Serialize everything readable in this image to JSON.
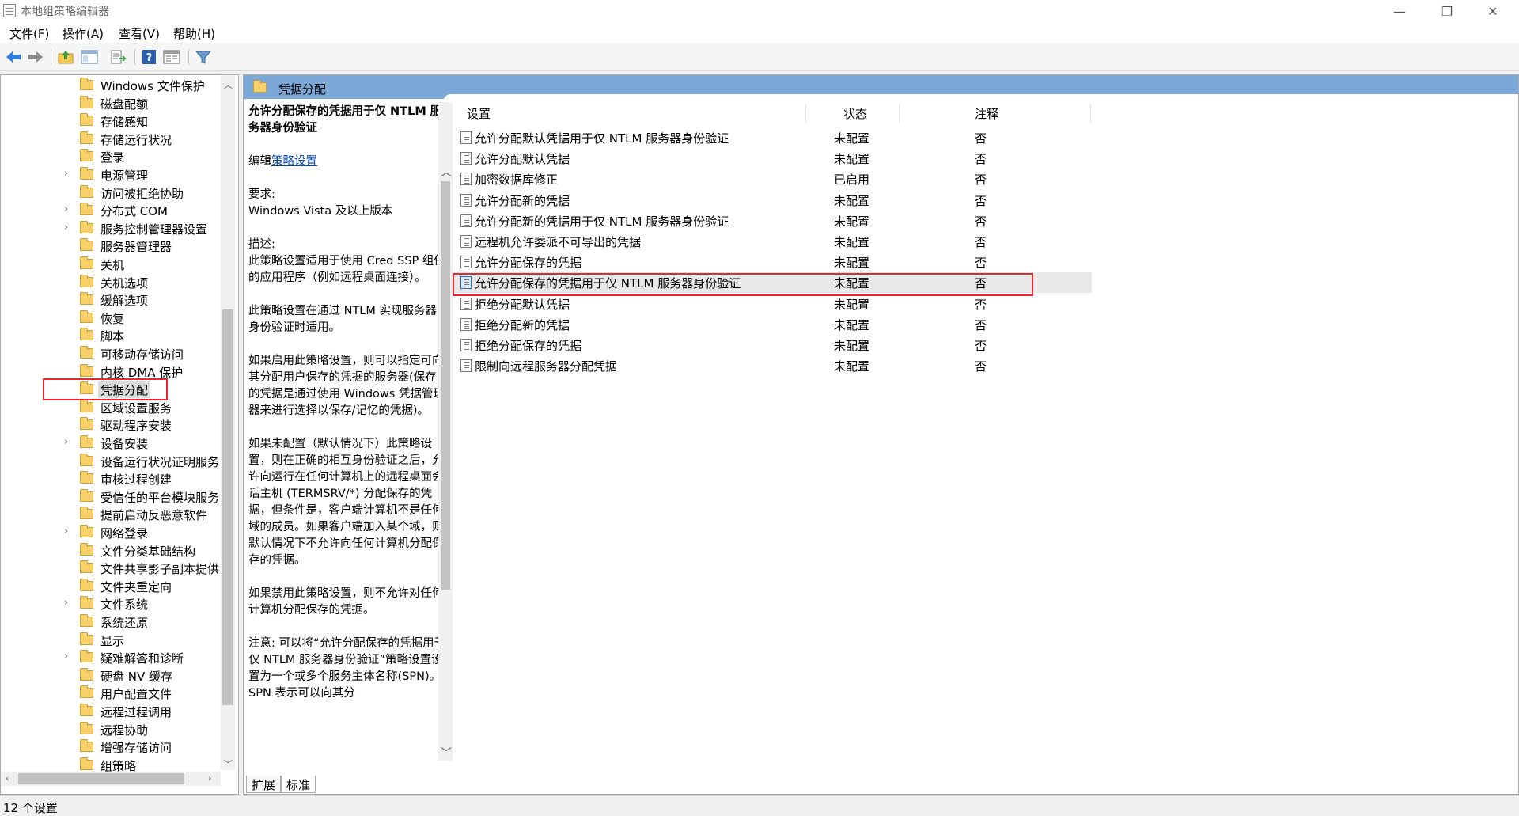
{
  "window": {
    "title": "本地组策略编辑器",
    "minimize": "—",
    "restore": "❐",
    "close": "✕"
  },
  "menu": [
    "文件(F)",
    "操作(A)",
    "查看(V)",
    "帮助(H)"
  ],
  "toolbar": [
    "back-icon",
    "forward-icon",
    "up-folder-icon",
    "show-hide-tree-icon",
    "export-list-icon",
    "help-icon",
    "properties-icon",
    "filter-icon"
  ],
  "tree": [
    {
      "label": "Windows 文件保护",
      "expandable": false
    },
    {
      "label": "磁盘配额",
      "expandable": false
    },
    {
      "label": "存储感知",
      "expandable": false
    },
    {
      "label": "存储运行状况",
      "expandable": false
    },
    {
      "label": "登录",
      "expandable": false
    },
    {
      "label": "电源管理",
      "expandable": true
    },
    {
      "label": "访问被拒绝协助",
      "expandable": false
    },
    {
      "label": "分布式 COM",
      "expandable": true
    },
    {
      "label": "服务控制管理器设置",
      "expandable": true
    },
    {
      "label": "服务器管理器",
      "expandable": false
    },
    {
      "label": "关机",
      "expandable": false
    },
    {
      "label": "关机选项",
      "expandable": false
    },
    {
      "label": "缓解选项",
      "expandable": false
    },
    {
      "label": "恢复",
      "expandable": false
    },
    {
      "label": "脚本",
      "expandable": false
    },
    {
      "label": "可移动存储访问",
      "expandable": false
    },
    {
      "label": "内核 DMA 保护",
      "expandable": false
    },
    {
      "label": "凭据分配",
      "expandable": false,
      "selected": true
    },
    {
      "label": "区域设置服务",
      "expandable": false
    },
    {
      "label": "驱动程序安装",
      "expandable": false
    },
    {
      "label": "设备安装",
      "expandable": true
    },
    {
      "label": "设备运行状况证明服务",
      "expandable": false
    },
    {
      "label": "审核过程创建",
      "expandable": false
    },
    {
      "label": "受信任的平台模块服务",
      "expandable": false
    },
    {
      "label": "提前启动反恶意软件",
      "expandable": false
    },
    {
      "label": "网络登录",
      "expandable": true
    },
    {
      "label": "文件分类基础结构",
      "expandable": false
    },
    {
      "label": "文件共享影子副本提供",
      "expandable": false
    },
    {
      "label": "文件夹重定向",
      "expandable": false
    },
    {
      "label": "文件系统",
      "expandable": true
    },
    {
      "label": "系统还原",
      "expandable": false
    },
    {
      "label": "显示",
      "expandable": false
    },
    {
      "label": "疑难解答和诊断",
      "expandable": true
    },
    {
      "label": "硬盘 NV 缓存",
      "expandable": false
    },
    {
      "label": "用户配置文件",
      "expandable": false
    },
    {
      "label": "远程过程调用",
      "expandable": false
    },
    {
      "label": "远程协助",
      "expandable": false
    },
    {
      "label": "增强存储访问",
      "expandable": false
    },
    {
      "label": "组策略",
      "expandable": false
    }
  ],
  "header": {
    "title": "凭据分配"
  },
  "description": {
    "title": "允许分配保存的凭据用于仅 NTLM 服务器身份验证",
    "edit_prefix": "编辑",
    "edit_link": "策略设置",
    "req_label": "要求:",
    "req_value": "Windows Vista 及以上版本",
    "desc_label": "描述:",
    "p1": "此策略设置适用于使用 Cred SSP 组件的应用程序（例如远程桌面连接）。",
    "p2": "此策略设置在通过 NTLM 实现服务器身份验证时适用。",
    "p3": "如果启用此策略设置，则可以指定可向其分配用户保存的凭据的服务器(保存的凭据是通过使用 Windows 凭据管理器来进行选择以保存/记忆的凭据)。",
    "p4": "如果未配置（默认情况下）此策略设置，则在正确的相互身份验证之后，允许向运行在任何计算机上的远程桌面会话主机 (TERMSRV/*) 分配保存的凭据，但条件是，客户端计算机不是任何域的成员。如果客户端加入某个域，则默认情况下不允许向任何计算机分配保存的凭据。",
    "p5": "如果禁用此策略设置，则不允许对任何计算机分配保存的凭据。",
    "p6": "注意: 可以将“允许分配保存的凭据用于仅 NTLM 服务器身份验证”策略设置设置为一个或多个服务主体名称(SPN)。SPN 表示可以向其分"
  },
  "columns": {
    "setting": "设置",
    "state": "状态",
    "note": "注释"
  },
  "policies": [
    {
      "name": "允许分配默认凭据用于仅 NTLM 服务器身份验证",
      "state": "未配置",
      "note": "否"
    },
    {
      "name": "允许分配默认凭据",
      "state": "未配置",
      "note": "否"
    },
    {
      "name": "加密数据库修正",
      "state": "已启用",
      "note": "否"
    },
    {
      "name": "允许分配新的凭据",
      "state": "未配置",
      "note": "否"
    },
    {
      "name": "允许分配新的凭据用于仅 NTLM 服务器身份验证",
      "state": "未配置",
      "note": "否"
    },
    {
      "name": "远程机允许委派不可导出的凭据",
      "state": "未配置",
      "note": "否"
    },
    {
      "name": "允许分配保存的凭据",
      "state": "未配置",
      "note": "否"
    },
    {
      "name": "允许分配保存的凭据用于仅 NTLM 服务器身份验证",
      "state": "未配置",
      "note": "否",
      "selected": true
    },
    {
      "name": "拒绝分配默认凭据",
      "state": "未配置",
      "note": "否"
    },
    {
      "name": "拒绝分配新的凭据",
      "state": "未配置",
      "note": "否"
    },
    {
      "name": "拒绝分配保存的凭据",
      "state": "未配置",
      "note": "否"
    },
    {
      "name": "限制向远程服务器分配凭据",
      "state": "未配置",
      "note": "否"
    }
  ],
  "tabs": [
    "扩展",
    "标准"
  ],
  "status": "12 个设置",
  "colors": {
    "header_strip": "#7ba7d6",
    "highlight": "#e6282d",
    "link": "#0645ad"
  }
}
